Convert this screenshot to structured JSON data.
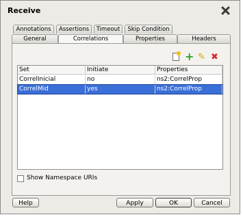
{
  "dialog": {
    "title": "Receive"
  },
  "tabs": {
    "back_row": [
      {
        "label": "Annotations"
      },
      {
        "label": "Assertions"
      },
      {
        "label": "Timeout"
      },
      {
        "label": "Skip Condition"
      }
    ],
    "front_row": [
      {
        "label": "General"
      },
      {
        "label": "Correlations",
        "active": true
      },
      {
        "label": "Properties"
      },
      {
        "label": "Headers"
      }
    ]
  },
  "toolbar": {
    "icons": [
      "new-icon",
      "add-icon",
      "edit-icon",
      "delete-icon"
    ],
    "add_glyph": "+",
    "edit_glyph": "✎",
    "delete_glyph": "✖"
  },
  "table": {
    "columns": [
      "Set",
      "Initiate",
      "Properties"
    ],
    "rows": [
      {
        "set": "CorrelInicial",
        "initiate": "no",
        "properties": "ns2:CorrelProp",
        "selected": false
      },
      {
        "set": "CorrelMid",
        "initiate": "yes",
        "properties": "ns2:CorrelProp",
        "selected": true
      }
    ]
  },
  "options": {
    "show_namespace_label": "Show Namespace URIs",
    "show_namespace_checked": false
  },
  "buttons": {
    "help": "Help",
    "apply": "Apply",
    "ok": "OK",
    "cancel": "Cancel"
  },
  "colors": {
    "selection": "#3a6fd7",
    "dialog_bg": "#ecebe6"
  }
}
